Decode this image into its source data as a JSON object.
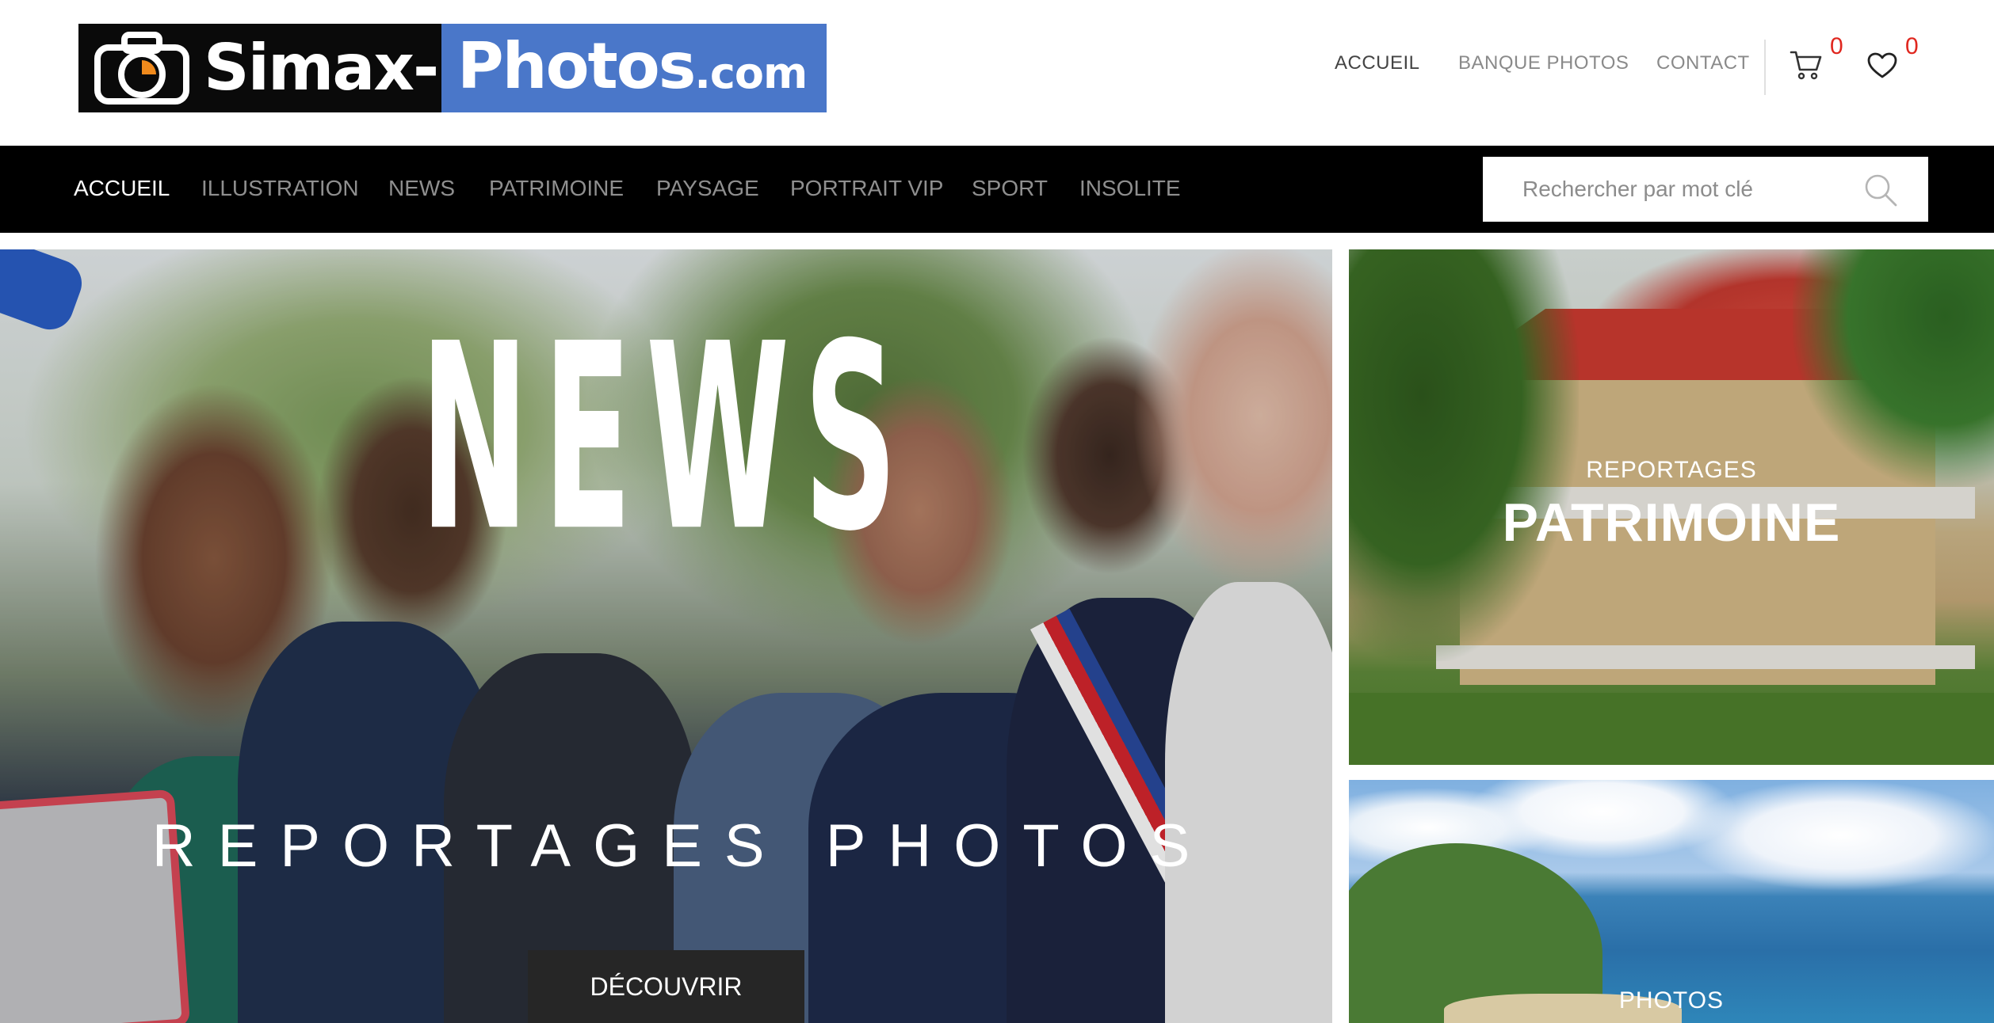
{
  "header": {
    "logo": {
      "part1": "Simax-",
      "part2": "Photos",
      "part3": ".com"
    },
    "nav": [
      {
        "label": "ACCUEIL"
      },
      {
        "label": "BANQUE PHOTOS"
      },
      {
        "label": "CONTACT"
      }
    ],
    "cart_count": "0",
    "wishlist_count": "0"
  },
  "categories": [
    {
      "label": "ACCUEIL"
    },
    {
      "label": "ILLUSTRATION"
    },
    {
      "label": "NEWS"
    },
    {
      "label": "PATRIMOINE"
    },
    {
      "label": "PAYSAGE"
    },
    {
      "label": "PORTRAIT VIP"
    },
    {
      "label": "SPORT"
    },
    {
      "label": "INSOLITE"
    }
  ],
  "search": {
    "placeholder": "Rechercher par mot clé"
  },
  "hero": {
    "title": "NEWS",
    "subtitle": "REPORTAGES PHOTOS",
    "button": "DÉCOUVRIR"
  },
  "cards": [
    {
      "kicker": "REPORTAGES",
      "title": "PATRIMOINE"
    },
    {
      "kicker": "PHOTOS"
    }
  ],
  "colors": {
    "logo_blue": "#4a77c9",
    "badge_red": "#e0271f",
    "category_bar": "#000000"
  },
  "icons": [
    "camera-icon",
    "cart-icon",
    "heart-icon",
    "search-icon"
  ]
}
